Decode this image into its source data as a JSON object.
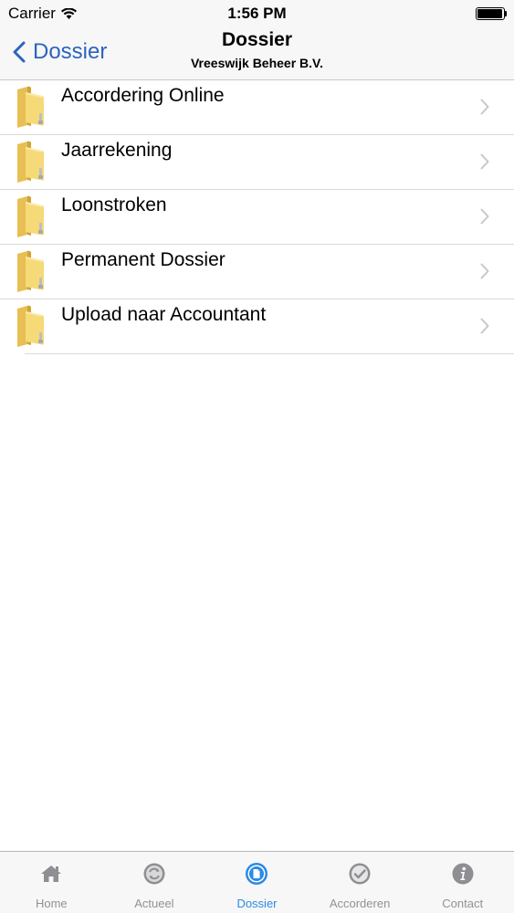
{
  "status_bar": {
    "carrier": "Carrier",
    "time": "1:56 PM"
  },
  "nav": {
    "back_label": "Dossier",
    "title": "Dossier",
    "subtitle": "Vreeswijk Beheer B.V."
  },
  "list": {
    "items": [
      {
        "label": "Accordering Online",
        "icon": "folder-icon"
      },
      {
        "label": "Jaarrekening",
        "icon": "folder-icon"
      },
      {
        "label": "Loonstroken",
        "icon": "folder-icon"
      },
      {
        "label": "Permanent Dossier",
        "icon": "folder-icon"
      },
      {
        "label": "Upload naar Accountant",
        "icon": "folder-icon"
      }
    ]
  },
  "tab_bar": {
    "active": "Dossier",
    "tabs": [
      {
        "label": "Home",
        "icon": "home-icon"
      },
      {
        "label": "Actueel",
        "icon": "refresh-icon"
      },
      {
        "label": "Dossier",
        "icon": "document-icon"
      },
      {
        "label": "Accorderen",
        "icon": "checkmark-icon"
      },
      {
        "label": "Contact",
        "icon": "info-icon"
      }
    ]
  },
  "colors": {
    "accent": "#2b64be",
    "tab_active": "#2b8ae6",
    "tab_inactive": "#929292",
    "folder": "#f3d36a"
  }
}
